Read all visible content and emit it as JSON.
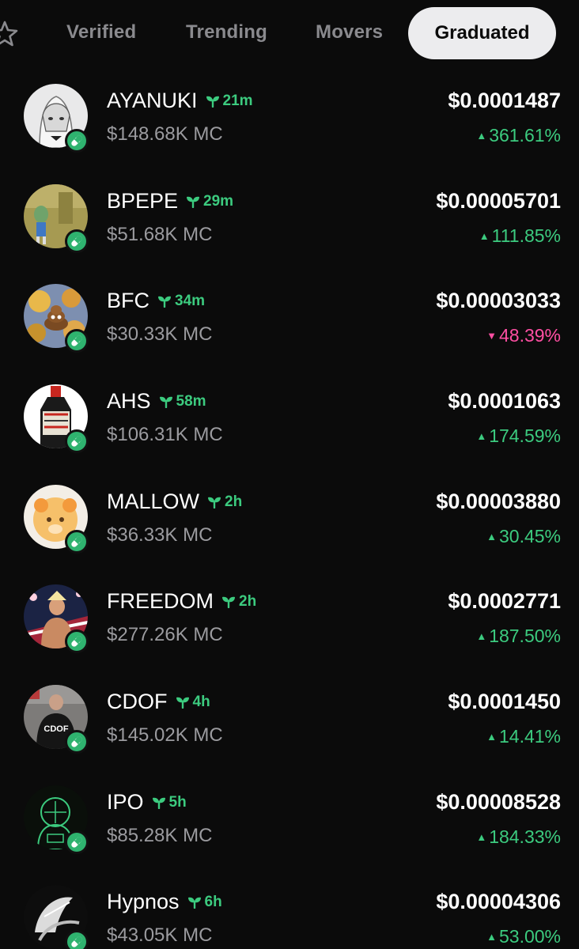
{
  "colors": {
    "background": "#0b0b0b",
    "positive": "#3ccb7f",
    "negative": "#ff4fa3",
    "muted_text": "#9b9b9f",
    "active_tab_bg": "#ececee"
  },
  "tabs": {
    "star_icon": "star-outline-icon",
    "verified": "Verified",
    "trending": "Trending",
    "movers": "Movers",
    "graduated": "Graduated",
    "active": "Graduated"
  },
  "tokens": [
    {
      "name": "AYANUKI",
      "age": "21m",
      "mc": "$148.68K MC",
      "price": "$0.0001487",
      "change": "361.61%",
      "direction": "up"
    },
    {
      "name": "BPEPE",
      "age": "29m",
      "mc": "$51.68K MC",
      "price": "$0.00005701",
      "change": "111.85%",
      "direction": "up"
    },
    {
      "name": "BFC",
      "age": "34m",
      "mc": "$30.33K MC",
      "price": "$0.00003033",
      "change": "48.39%",
      "direction": "down"
    },
    {
      "name": "AHS",
      "age": "58m",
      "mc": "$106.31K MC",
      "price": "$0.0001063",
      "change": "174.59%",
      "direction": "up"
    },
    {
      "name": "MALLOW",
      "age": "2h",
      "mc": "$36.33K MC",
      "price": "$0.00003880",
      "change": "30.45%",
      "direction": "up"
    },
    {
      "name": "FREEDOM",
      "age": "2h",
      "mc": "$277.26K MC",
      "price": "$0.0002771",
      "change": "187.50%",
      "direction": "up"
    },
    {
      "name": "CDOF",
      "age": "4h",
      "mc": "$145.02K MC",
      "price": "$0.0001450",
      "change": "14.41%",
      "direction": "up"
    },
    {
      "name": "IPO",
      "age": "5h",
      "mc": "$85.28K MC",
      "price": "$0.00008528",
      "change": "184.33%",
      "direction": "up"
    },
    {
      "name": "Hypnos",
      "age": "6h",
      "mc": "$43.05K MC",
      "price": "$0.00004306",
      "change": "53.00%",
      "direction": "up"
    }
  ],
  "avatar_text": {
    "cdof": "CDOF"
  }
}
